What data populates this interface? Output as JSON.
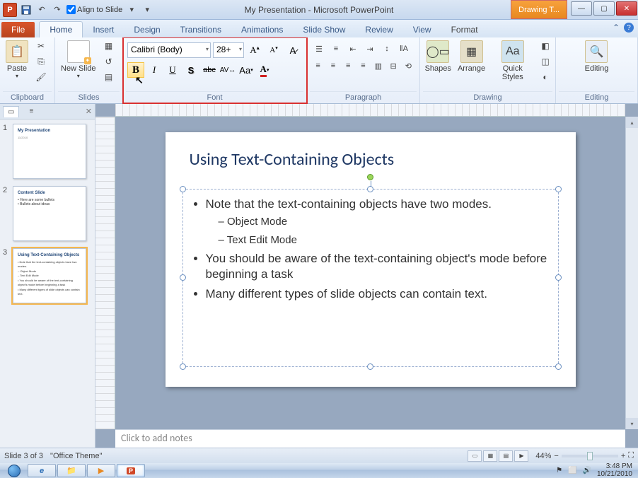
{
  "titlebar": {
    "app_title": "My Presentation  -  Microsoft PowerPoint",
    "align_label": "Align to Slide",
    "context_tab": "Drawing T...",
    "min": "—",
    "max": "▢",
    "close": "✕"
  },
  "tabs": {
    "file": "File",
    "home": "Home",
    "insert": "Insert",
    "design": "Design",
    "transitions": "Transitions",
    "animations": "Animations",
    "slideshow": "Slide Show",
    "review": "Review",
    "view": "View",
    "format": "Format"
  },
  "ribbon": {
    "clipboard": {
      "label": "Clipboard",
      "paste": "Paste"
    },
    "slides": {
      "label": "Slides",
      "new": "New Slide"
    },
    "font": {
      "label": "Font",
      "family": "Calibri (Body)",
      "size": "28+"
    },
    "paragraph": {
      "label": "Paragraph"
    },
    "drawing": {
      "label": "Drawing",
      "shapes": "Shapes",
      "arrange": "Arrange",
      "quick": "Quick Styles"
    },
    "editing": {
      "label": "Editing"
    }
  },
  "panel": {
    "tab1": "",
    "tab2": "",
    "close": "✕"
  },
  "thumbs": [
    {
      "n": "1",
      "title": "My Presentation",
      "body": ""
    },
    {
      "n": "2",
      "title": "Content Slide",
      "body": "• Here are some bullets\n• Bullets about ideas"
    },
    {
      "n": "3",
      "title": "Using Text-Containing Objects",
      "body": "• Note that the text-containing objects have two modes.\n  – Object Mode\n  – Text Edit Mode\n• You should be aware of the text-containing object's mode before beginning a task\n• Many different types of slide objects can contain text."
    }
  ],
  "slide": {
    "title": "Using Text-Containing Objects",
    "b1": "Note that the text-containing objects have two modes.",
    "b1a": "Object Mode",
    "b1b": "Text Edit Mode",
    "b2": "You should be aware of the text-containing object's mode before beginning a task",
    "b3": "Many different types of slide objects can contain text."
  },
  "notes_placeholder": "Click to add notes",
  "status": {
    "slide": "Slide 3 of 3",
    "theme": "\"Office Theme\"",
    "zoom": "44%"
  },
  "tray": {
    "time": "3:48 PM",
    "date": "10/21/2010"
  }
}
